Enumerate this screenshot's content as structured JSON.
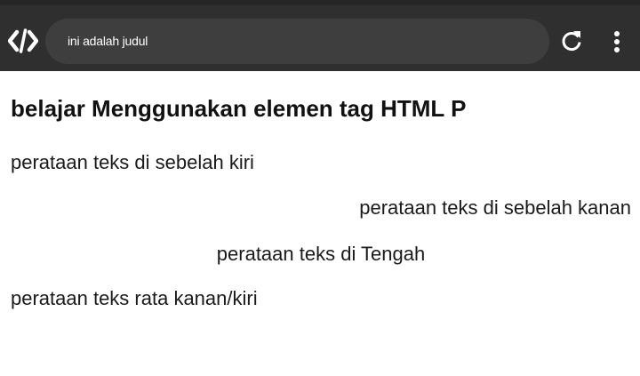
{
  "browser": {
    "url_text": "ini adalah judul",
    "logo_icon": "code-brackets-icon",
    "reload_icon": "reload-icon",
    "menu_icon": "kebab-menu-icon",
    "toolbar_color": "#2f2f2f",
    "urlbar_color": "#3e3e3e"
  },
  "page": {
    "heading": "belajar Menggunakan elemen tag HTML P",
    "paragraphs": {
      "left": "perataan teks di sebelah kiri",
      "right": "perataan teks di sebelah kanan",
      "center": "perataan teks di Tengah",
      "justify": "perataan teks rata kanan/kiri"
    }
  }
}
